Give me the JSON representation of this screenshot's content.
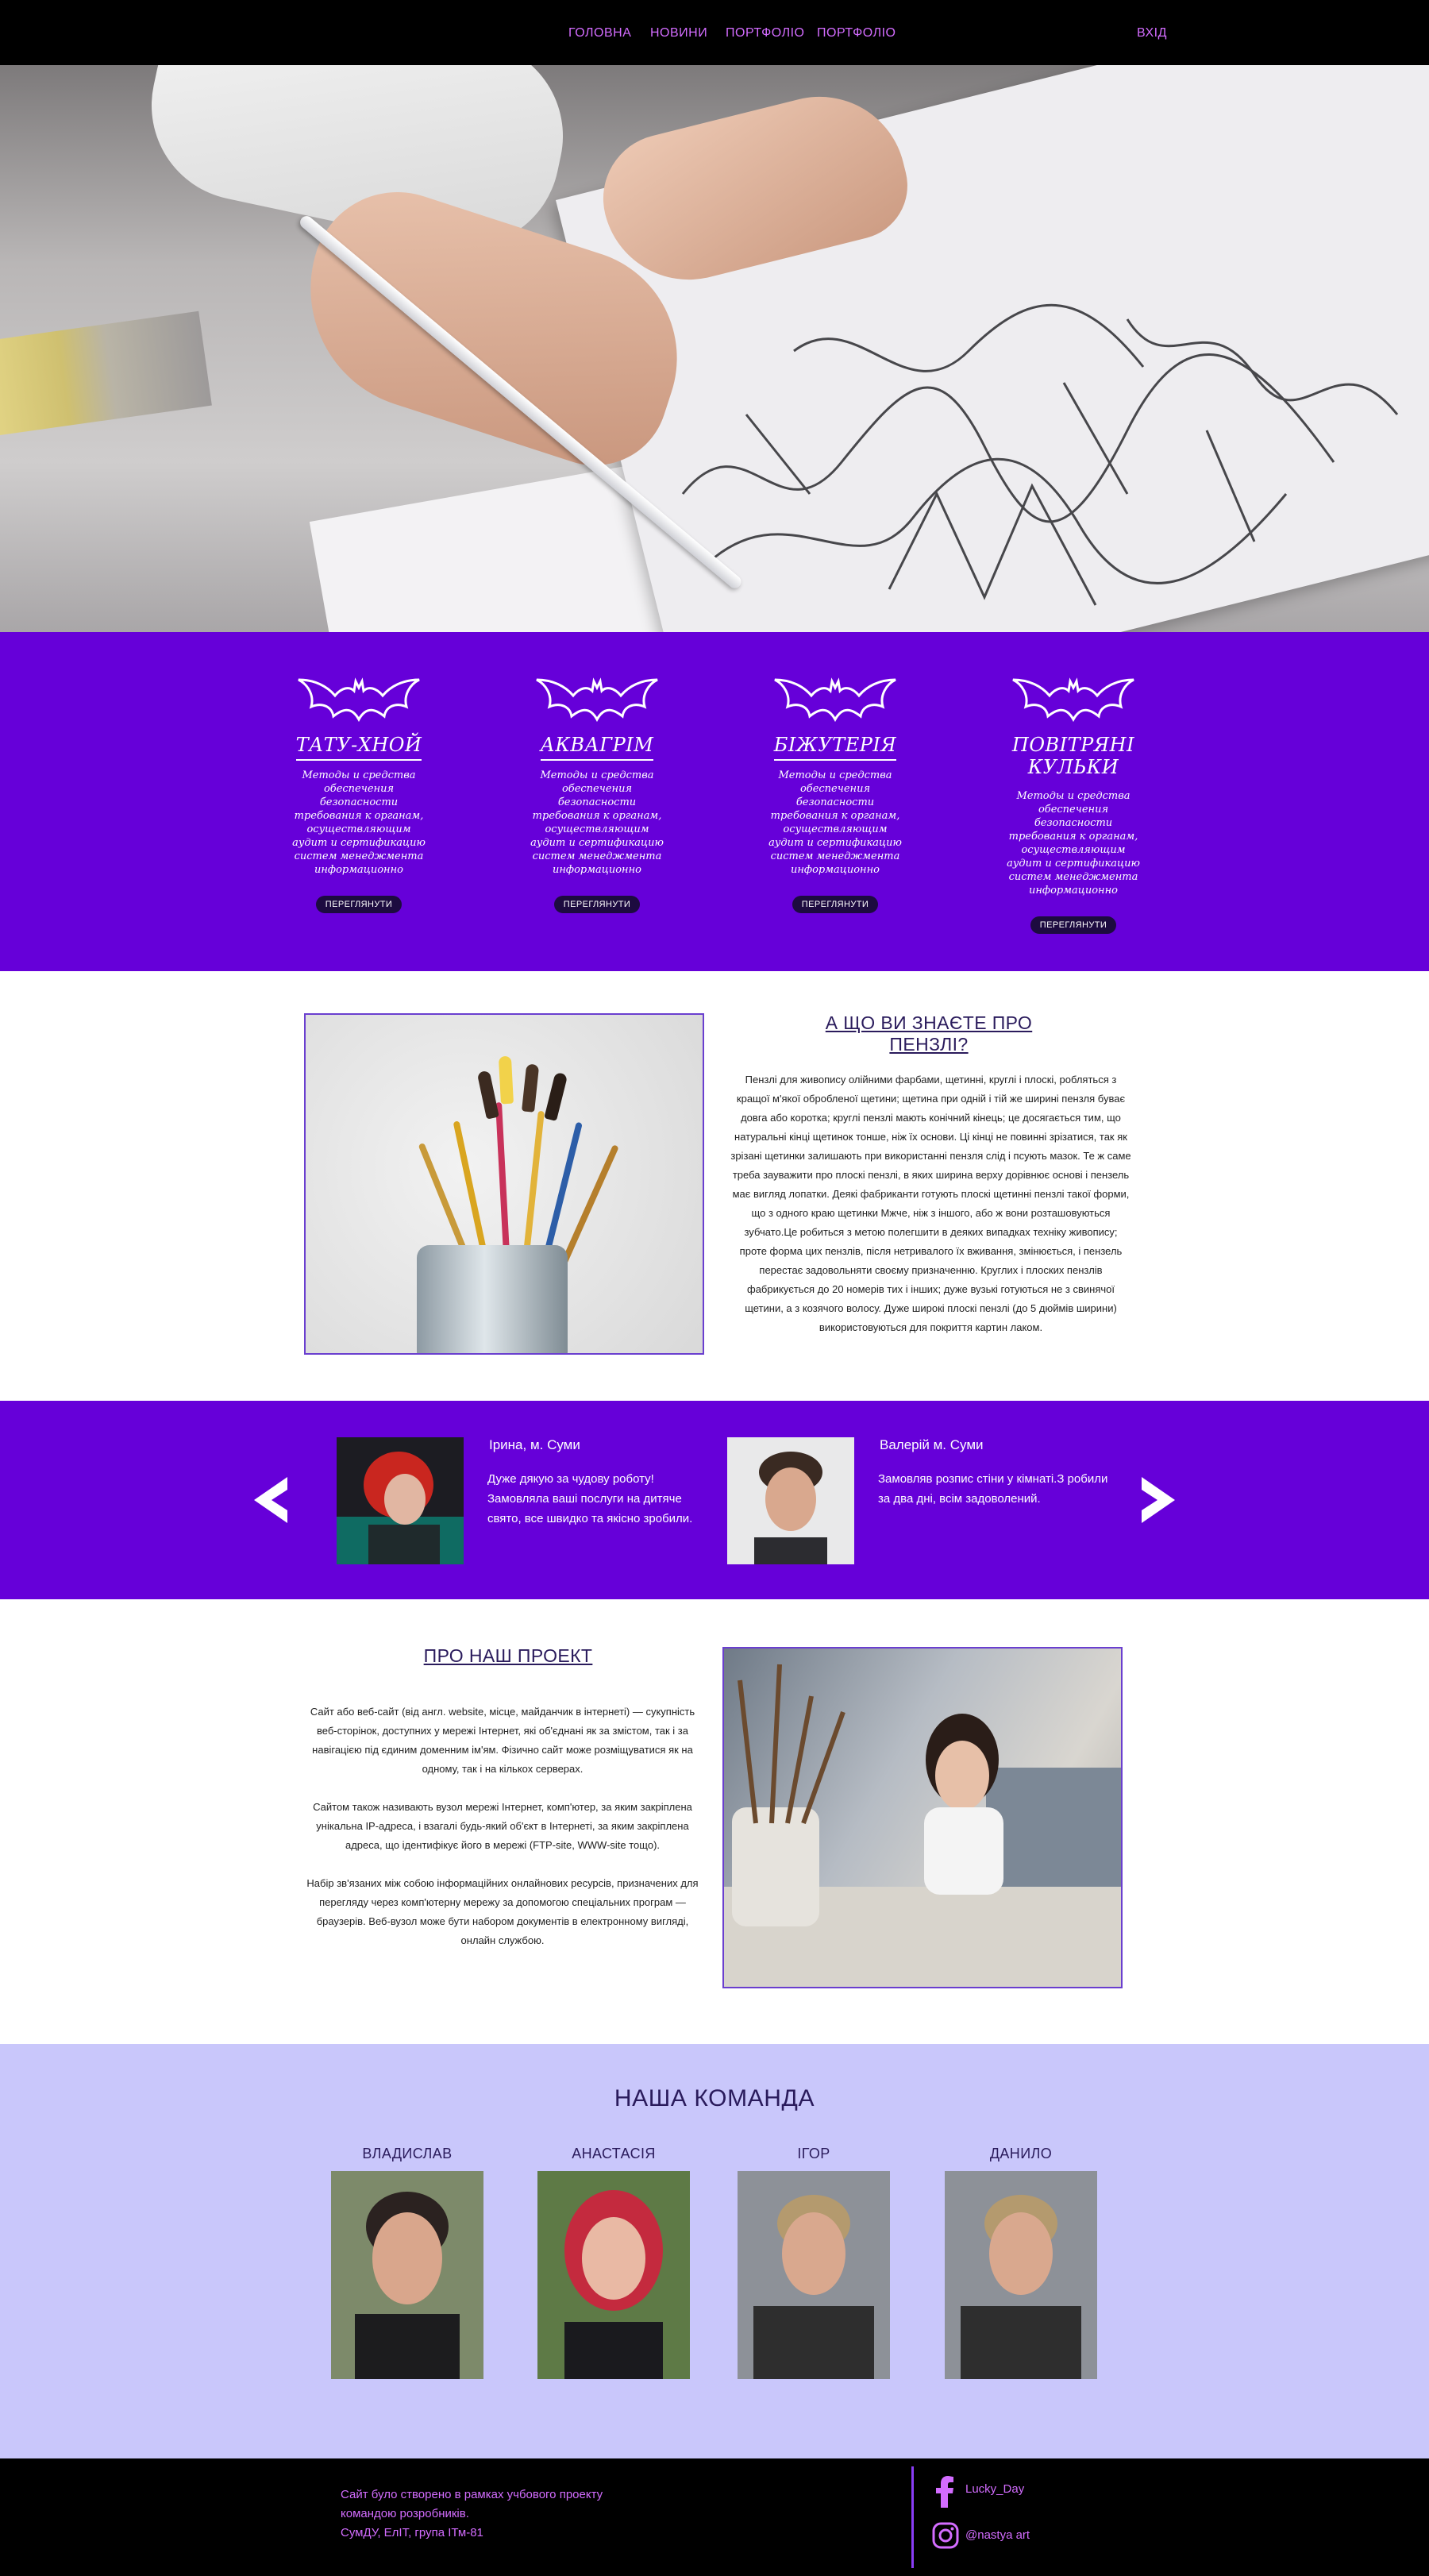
{
  "nav": {
    "items": [
      "ГОЛОВНА",
      "НОВИНИ",
      "ПОРТФОЛІО",
      "ПОРТФОЛІО"
    ],
    "login": "ВХІД"
  },
  "services": {
    "items": [
      {
        "title": "ТАТУ-ХНОЙ",
        "desc": "Методы и средства обеспечения безопасности требования к органам, осуществляющим аудит и сертификацию систем менеджмента информационно",
        "button": "ПЕРЕГЛЯНУТИ"
      },
      {
        "title": "АКВАГРІМ",
        "desc": "Методы и средства обеспечения безопасности требования к органам, осуществляющим аудит и сертификацию систем менеджмента информационно",
        "button": "ПЕРЕГЛЯНУТИ"
      },
      {
        "title": "БІЖУТЕРІЯ",
        "desc": "Методы и средства обеспечения безопасности требования к органам, осуществляющим аудит и сертификацию систем менеджмента информационно",
        "button": "ПЕРЕГЛЯНУТИ"
      },
      {
        "title": "ПОВІТРЯНІ КУЛЬКИ",
        "desc": "Методы и средства обеспечения безопасности требования к органам, осуществляющим аудит и сертификацию систем менеджмента информационно",
        "button": "ПЕРЕГЛЯНУТИ"
      }
    ]
  },
  "article": {
    "title": "А ЩО ВИ ЗНАЄТЕ ПРО ПЕНЗЛІ?",
    "body": "Пензлі для живопису олійними фарбами, щетинні, круглі і плоскі, робляться з кращої м'якої обробленої щетини; щетина при одній і тій же ширині пензля буває довга або коротка; круглі пензлі мають конічний кінець; це досягається тим, що натуральні кінці щетинок тонше, ніж їх основи. Ці кінці не повинні зрізатися, так як зрізані щетинки залишають при використанні пензля слід і псують мазок. Те ж саме треба зауважити про плоскі пензлі, в яких ширина верху дорівнює основі і пензель має вигляд лопатки. Деякі фабриканти готують плоскі щетинні пензлі такої форми, що з одного краю щетинки Мжче, ніж з іншого, або ж вони розташовуються зубчато.Це робиться з метою полегшити в деяких випадках техніку живопису; проте форма цих пензлів, після нетривалого їх вживання, змінюється, і пензель перестає задовольняти своєму призначенню. Круглих і плоских пензлів фабрикується до 20 номерів тих і інших; дуже вузькі готуються не з свинячої щетини, а з козячого волосу. Дуже широкі плоскі пензлі (до 5 дюймів ширини) використовуються для покриття картин лаком."
  },
  "testimonials": [
    {
      "name": "Ірина, м. Суми",
      "text": "Дуже дякую за чудову роботу! Замовляла ваші послуги на дитяче свято, все швидко та якісно зробили."
    },
    {
      "name": "Валерій м. Суми",
      "text": "Замовляв розпис стіни у кімнаті.З робили за два дні, всім задоволений."
    }
  ],
  "project": {
    "title": "ПРО НАШ ПРОЕКТ",
    "paragraphs": [
      "Сайт або веб-сайт (від англ. website, місце, майданчик в інтернеті) — сукупність веб-сторінок, доступних у мережі Інтернет, які об'єднані як за змістом, так і за навігацією під єдиним доменним ім'ям. Фізично сайт може розміщуватися як на одному, так і на кількох серверах.",
      "Сайтом також називають вузол мережі Інтернет, комп'ютер, за яким закріплена унікальна IP-адреса, і взагалі будь-який об'єкт в Інтернеті, за яким закріплена адреса, що ідентифікує його в мережі (FTP-site, WWW-site тощо).",
      "Набір зв'язаних між собою інформаційних онлайнових ресурсів, призначених для перегляду через комп'ютерну мережу за допомогою спеціальних програм — браузерів. Веб-вузол може бути набором документів в електронному вигляді, онлайн службою."
    ]
  },
  "team": {
    "title": "НАША КОМАНДА",
    "members": [
      "ВЛАДИСЛАВ",
      "АНАСТАСІЯ",
      "ІГОР",
      "ДАНИЛО"
    ]
  },
  "footer": {
    "lines": [
      "Сайт було створено в рамках учбового проекту",
      "командою розробників.",
      "СумДУ, ЕлІТ, група ІТм-81"
    ],
    "facebook": "Lucky_Day",
    "instagram": "@nastya art"
  },
  "colors": {
    "purple": "#6600d9",
    "lavender": "#c9c7fb",
    "accent": "#d36cff",
    "dark": "#000000"
  }
}
